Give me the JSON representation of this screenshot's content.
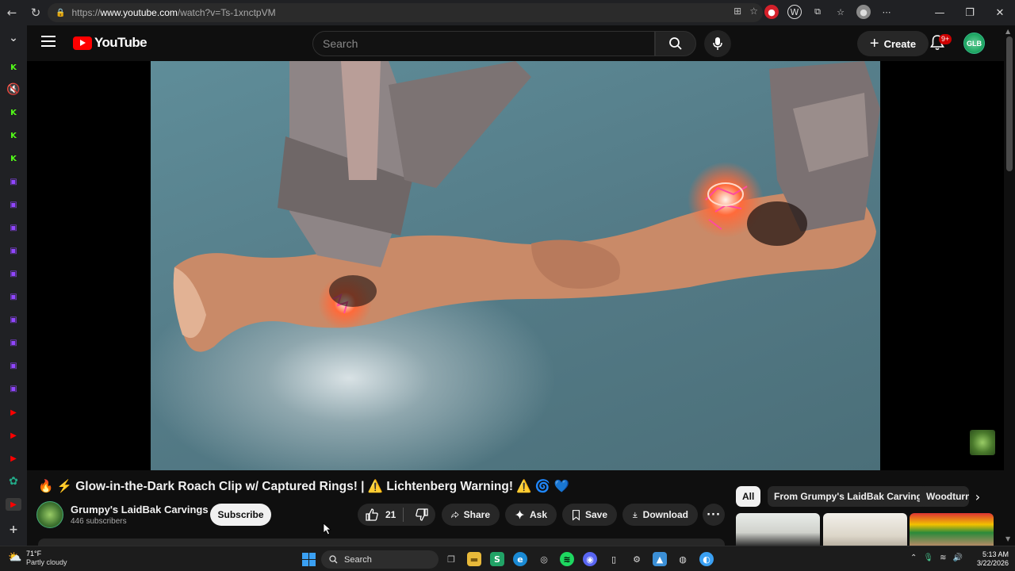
{
  "browser": {
    "url_prefix": "https://",
    "url_host": "www.youtube.com",
    "url_path": "/watch?v=Ts-1xnctpVM"
  },
  "header": {
    "logo_text": "YouTube",
    "search_placeholder": "Search",
    "create_label": "Create",
    "notifications_badge": "9+",
    "account_initials": "GLB"
  },
  "video": {
    "title": "🔥 ⚡ Glow-in-the-Dark Roach Clip w/ Captured Rings! | ⚠️ Lichtenberg Warning! ⚠️ 🌀 💙"
  },
  "channel": {
    "name": "Grumpy's LaidBak Carvings",
    "subscribers": "446 subscribers",
    "subscribe_label": "Subscribe"
  },
  "actions": {
    "likes": "21",
    "share": "Share",
    "ask": "Ask",
    "save": "Save",
    "download": "Download"
  },
  "chips": [
    {
      "label": "All",
      "active": true
    },
    {
      "label": "From Grumpy's LaidBak Carvings",
      "active": false
    },
    {
      "label": "Woodturning",
      "active": false
    }
  ],
  "taskbar": {
    "temperature": "71°F",
    "condition": "Partly cloudy",
    "search_placeholder": "Search",
    "time": "5:13 AM",
    "date": "3/22/2026"
  },
  "colors": {
    "background": "#0f0f0f",
    "youtube_red": "#ff0000",
    "pill_bg": "#272727",
    "accent_blue": "#3ea6ff"
  }
}
